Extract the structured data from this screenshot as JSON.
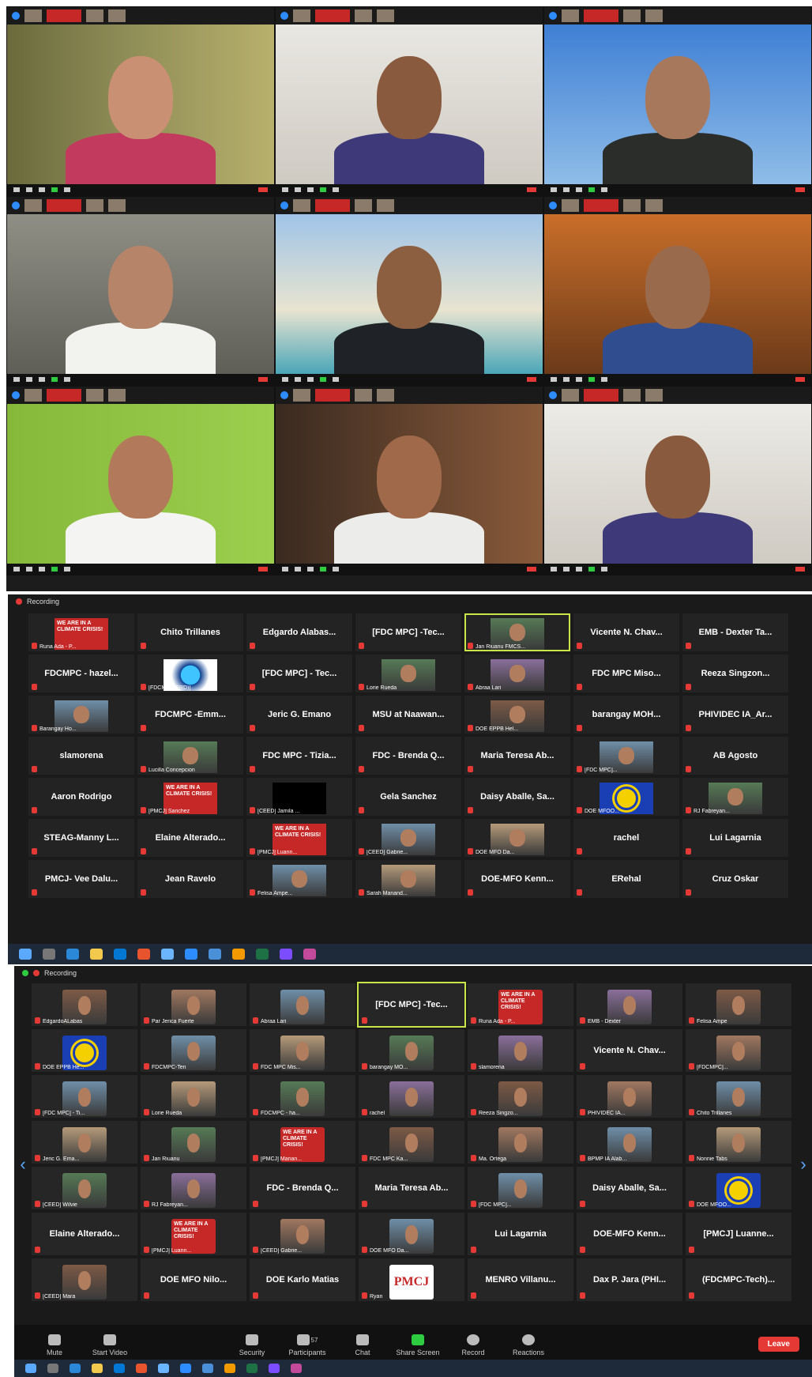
{
  "recording_label": "Recording",
  "gallery1": {
    "tiles": [
      {
        "name": "",
        "label": "Runa Ada - P...",
        "kind": "climate",
        "climate_text": "WE ARE IN A CLIMATE CRISIS!"
      },
      {
        "name": "Chito Trillanes"
      },
      {
        "name": "Edgardo Alabas..."
      },
      {
        "name": "[FDC MPC] -Tec..."
      },
      {
        "name": "",
        "label": "Jan Riuanu FMCS...",
        "kind": "face",
        "active": true
      },
      {
        "name": "Vicente N. Chav..."
      },
      {
        "name": "EMB - Dexter Ta..."
      },
      {
        "name": "FDCMPC - hazel..."
      },
      {
        "name": "",
        "label": "[FDCMPC(ERD)]",
        "kind": "logo"
      },
      {
        "name": "[FDC MPC] - Tec..."
      },
      {
        "name": "",
        "label": "Lorie Rueda",
        "kind": "face"
      },
      {
        "name": "",
        "label": "Abraa Lari",
        "kind": "face"
      },
      {
        "name": "FDC MPC Miso..."
      },
      {
        "name": "Reeza Singzon..."
      },
      {
        "name": "",
        "label": "Barangay Ho...",
        "kind": "face"
      },
      {
        "name": "FDCMPC -Emm..."
      },
      {
        "name": "Jeric G. Emano"
      },
      {
        "name": "MSU at Naawan..."
      },
      {
        "name": "",
        "label": "DOE EPPB Hel...",
        "kind": "face"
      },
      {
        "name": "barangay MOH..."
      },
      {
        "name": "PHIVIDEC IA_Ar..."
      },
      {
        "name": "slamorena"
      },
      {
        "name": "",
        "label": "Lucilla Concepcion",
        "kind": "face"
      },
      {
        "name": "FDC MPC - Tizia..."
      },
      {
        "name": "FDC - Brenda Q..."
      },
      {
        "name": "Maria Teresa Ab..."
      },
      {
        "name": "",
        "label": "[FDC MPC]...",
        "kind": "face"
      },
      {
        "name": "AB Agosto"
      },
      {
        "name": "Aaron Rodrigo"
      },
      {
        "name": "",
        "label": "[PMCJ] Sanchez",
        "kind": "climate",
        "climate_text": "WE ARE IN A CLIMATE CRISIS!"
      },
      {
        "name": "",
        "label": "[CEED] Jamila ...",
        "kind": "dark"
      },
      {
        "name": "Gela Sanchez"
      },
      {
        "name": "Daisy Aballe, Sa..."
      },
      {
        "name": "",
        "label": "DOE MFOO...",
        "kind": "sun"
      },
      {
        "name": "",
        "label": "RJ Fabreyan...",
        "kind": "face"
      },
      {
        "name": "STEAG-Manny L..."
      },
      {
        "name": "Elaine Alterado..."
      },
      {
        "name": "",
        "label": "[PMCJ] Luann...",
        "kind": "climate",
        "climate_text": "WE ARE IN A CLIMATE CRISIS!"
      },
      {
        "name": "",
        "label": "[CEED] Gabrie...",
        "kind": "face"
      },
      {
        "name": "",
        "label": "DOE MFO Da...",
        "kind": "face"
      },
      {
        "name": "rachel"
      },
      {
        "name": "Lui Lagarnia"
      },
      {
        "name": "PMCJ- Vee Dalu..."
      },
      {
        "name": "Jean Ravelo"
      },
      {
        "name": "",
        "label": "Felisa Ampe...",
        "kind": "face"
      },
      {
        "name": "",
        "label": "Sarah Manand...",
        "kind": "face"
      },
      {
        "name": "DOE-MFO Kenn..."
      },
      {
        "name": "ERehal"
      },
      {
        "name": "Cruz Oskar"
      }
    ]
  },
  "gallery2": {
    "tiles": [
      {
        "name": "",
        "label": "EdgardoALabas",
        "kind": "face"
      },
      {
        "name": "",
        "label": "Par Jerica Fuerte",
        "kind": "face"
      },
      {
        "name": "",
        "label": "Abraa Lari",
        "kind": "face"
      },
      {
        "name": "[FDC MPC] -Tec...",
        "active": true
      },
      {
        "name": "",
        "label": "Runa Ada - P...",
        "kind": "climate",
        "climate_text": "WE ARE IN A CLIMATE CRISIS!"
      },
      {
        "name": "",
        "label": "EMB - Dexter",
        "kind": "face"
      },
      {
        "name": "",
        "label": "Felisa Ampe",
        "kind": "face"
      },
      {
        "name": "",
        "label": "DOE EPPB He...",
        "kind": "sun"
      },
      {
        "name": "",
        "label": "FDCMPC-Ten",
        "kind": "face"
      },
      {
        "name": "",
        "label": "FDC MPC Mis...",
        "kind": "face"
      },
      {
        "name": "",
        "label": "barangay MO...",
        "kind": "face"
      },
      {
        "name": "",
        "label": "slamorena",
        "kind": "face"
      },
      {
        "name": "Vicente N. Chav..."
      },
      {
        "name": "",
        "label": "[FDCMPC]...",
        "kind": "face"
      },
      {
        "name": "",
        "label": "[FDC MPC] - Ti...",
        "kind": "face"
      },
      {
        "name": "",
        "label": "Lorie Rueda",
        "kind": "face"
      },
      {
        "name": "",
        "label": "FDCMPC - ha...",
        "kind": "face"
      },
      {
        "name": "",
        "label": "rachel",
        "kind": "face"
      },
      {
        "name": "",
        "label": "Reeza Singzo...",
        "kind": "face"
      },
      {
        "name": "",
        "label": "PHIVIDEC IA...",
        "kind": "face"
      },
      {
        "name": "",
        "label": "Chito Trillanes",
        "kind": "face"
      },
      {
        "name": "",
        "label": "Jeric G. Ema...",
        "kind": "face"
      },
      {
        "name": "",
        "label": "Jan Riuanu",
        "kind": "face"
      },
      {
        "name": "",
        "label": "[PMCJ] Marian...",
        "kind": "climate",
        "climate_text": "WE ARE IN A CLIMATE CRISIS!"
      },
      {
        "name": "",
        "label": "FDC MPC Ka...",
        "kind": "face"
      },
      {
        "name": "",
        "label": "Ma. Ortega",
        "kind": "face"
      },
      {
        "name": "",
        "label": "BPMP IA Alab...",
        "kind": "face"
      },
      {
        "name": "",
        "label": "Nonnie Tabs",
        "kind": "face"
      },
      {
        "name": "",
        "label": "[CEED] Wilvie",
        "kind": "face"
      },
      {
        "name": "",
        "label": "RJ Fabreyan...",
        "kind": "face"
      },
      {
        "name": "FDC - Brenda Q..."
      },
      {
        "name": "Maria Teresa Ab..."
      },
      {
        "name": "",
        "label": "[FDC MPC]...",
        "kind": "face"
      },
      {
        "name": "Daisy Aballe, Sa..."
      },
      {
        "name": "",
        "label": "DOE MFOO...",
        "kind": "sun"
      },
      {
        "name": "Elaine Alterado..."
      },
      {
        "name": "",
        "label": "[PMCJ] Luann...",
        "kind": "climate",
        "climate_text": "WE ARE IN A CLIMATE CRISIS!"
      },
      {
        "name": "",
        "label": "[CEED] Gabrie...",
        "kind": "face"
      },
      {
        "name": "",
        "label": "DOE MFO Da...",
        "kind": "face"
      },
      {
        "name": "Lui Lagarnia"
      },
      {
        "name": "DOE-MFO Kenn..."
      },
      {
        "name": "[PMCJ] Luanne..."
      },
      {
        "name": "",
        "label": "[CEED] Mara",
        "kind": "face"
      },
      {
        "name": "DOE MFO Nilo..."
      },
      {
        "name": "DOE Karlo Matias"
      },
      {
        "name": "",
        "label": "Ryan",
        "kind": "pmcj",
        "logo_text": "PMCJ"
      },
      {
        "name": "MENRO Villanu..."
      },
      {
        "name": "Dax P. Jara (PHI..."
      },
      {
        "name": "(FDCMPC-Tech)..."
      }
    ],
    "toolbar": {
      "mute": "Mute",
      "start_video": "Start Video",
      "security": "Security",
      "participants": "Participants",
      "participants_count": "57",
      "chat": "Chat",
      "share_screen": "Share Screen",
      "record": "Record",
      "reactions": "Reactions",
      "leave": "Leave"
    }
  },
  "colors": {
    "zoom_blue": "#2d8cff",
    "recording_red": "#e53935",
    "active_speaker": "#c8e64a",
    "climate_red": "#c62828"
  }
}
